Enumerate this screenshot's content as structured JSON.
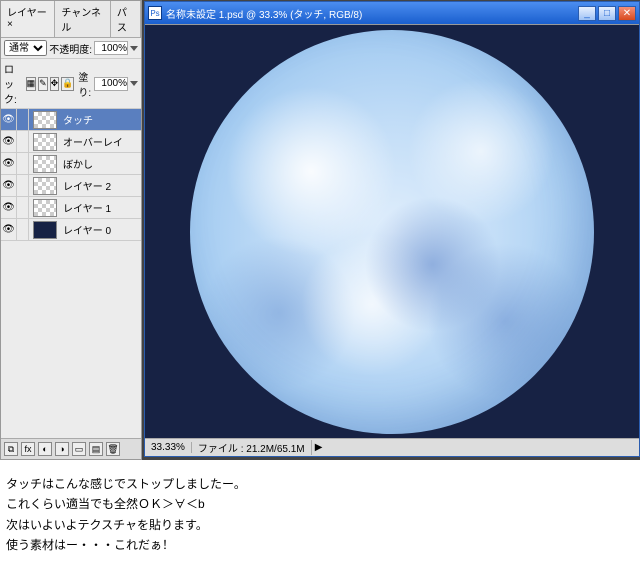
{
  "panel": {
    "tabs": [
      "レイヤー ×",
      "チャンネル",
      "パス"
    ],
    "blendMode": "通常",
    "opacityLabel": "不透明度:",
    "opacityValue": "100%",
    "lockLabel": "ロック:",
    "fillLabel": "塗り:",
    "fillValue": "100%",
    "layers": [
      {
        "name": "タッチ",
        "selected": true,
        "dark": false
      },
      {
        "name": "オーバーレイ",
        "selected": false,
        "dark": false
      },
      {
        "name": "ぼかし",
        "selected": false,
        "dark": false
      },
      {
        "name": "レイヤー 2",
        "selected": false,
        "dark": false
      },
      {
        "name": "レイヤー 1",
        "selected": false,
        "dark": false
      },
      {
        "name": "レイヤー 0",
        "selected": false,
        "dark": true
      }
    ]
  },
  "window": {
    "title": "名称未設定 1.psd @ 33.3% (タッチ, RGB/8)",
    "zoom": "33.33%",
    "docInfo": "ファイル : 21.2M/65.1M"
  },
  "caption": {
    "l1": "タッチはこんな感じでストップしましたー。",
    "l2": "これくらい適当でも全然ＯＫ＞∀＜b",
    "l3": "次はいよいよテクスチャを貼ります。",
    "l4": "使う素材はー・・・これだぁ！"
  }
}
